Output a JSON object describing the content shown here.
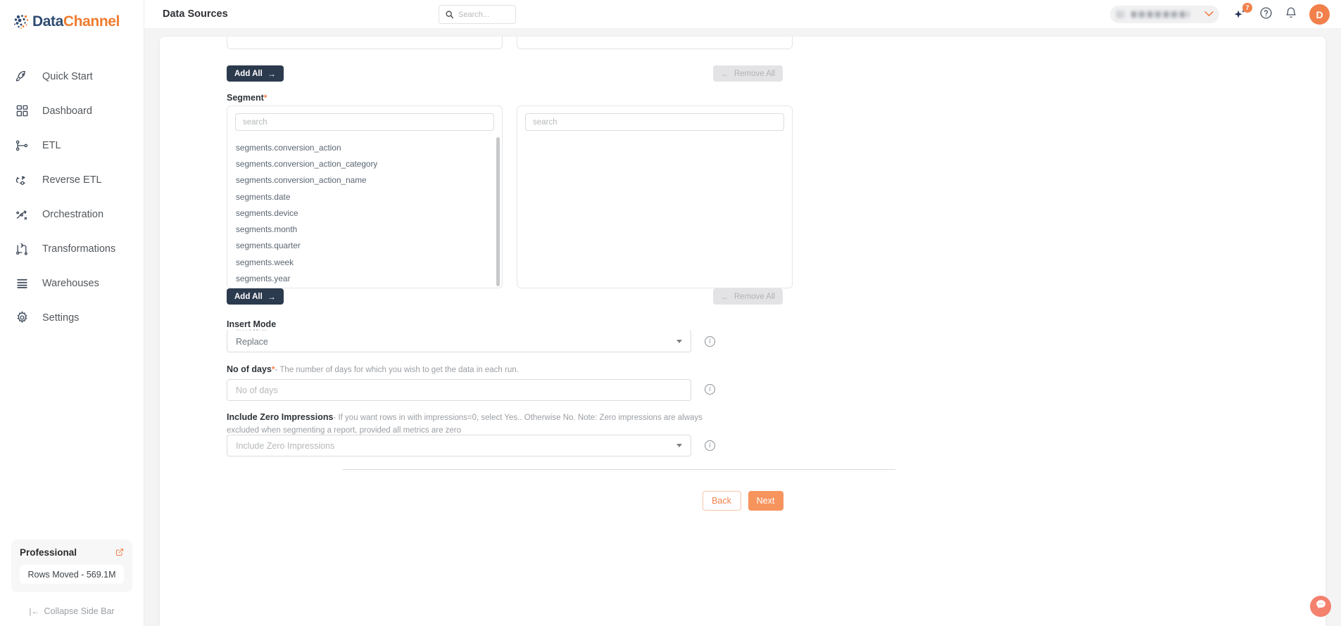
{
  "brand": {
    "name_part1": "Data",
    "name_part2": "Channel",
    "color_primary": "#2f4b72",
    "color_accent": "#f07c2e"
  },
  "sidebar": {
    "items": [
      {
        "label": "Quick Start",
        "icon": "rocket-icon"
      },
      {
        "label": "Dashboard",
        "icon": "grid-icon"
      },
      {
        "label": "ETL",
        "icon": "etl-icon"
      },
      {
        "label": "Reverse ETL",
        "icon": "reverse-etl-icon"
      },
      {
        "label": "Orchestration",
        "icon": "orchestration-icon"
      },
      {
        "label": "Transformations",
        "icon": "transformations-icon"
      },
      {
        "label": "Warehouses",
        "icon": "warehouse-icon"
      },
      {
        "label": "Settings",
        "icon": "gear-icon"
      }
    ],
    "plan": {
      "name": "Professional",
      "external_icon": "external-link-icon",
      "rows_moved": "Rows Moved - 569.1M"
    },
    "collapse": {
      "label": "Collapse Side Bar",
      "icon": "collapse-left-icon"
    }
  },
  "topbar": {
    "title": "Data Sources",
    "search": {
      "placeholder": "Search...",
      "value": "",
      "icon": "search-icon"
    },
    "workspace_selector": {
      "value": "",
      "chevron": "chevron-down-icon"
    },
    "ai_assistant": {
      "icon": "sparkle-icon",
      "badge": "7"
    },
    "help": {
      "icon": "help-circle-icon"
    },
    "notifications": {
      "icon": "bell-icon"
    },
    "avatar": {
      "initial": "D"
    }
  },
  "form": {
    "top_transfer": {
      "add_all_label": "Add All",
      "add_all_arrow": "→",
      "remove_all_label": "Remove All",
      "remove_all_arrow": "←"
    },
    "segment": {
      "label": "Segment",
      "required_mark": "*",
      "left_search_placeholder": "search",
      "right_search_placeholder": "search",
      "available_items": [
        "segments.conversion_action",
        "segments.conversion_action_category",
        "segments.conversion_action_name",
        "segments.date",
        "segments.device",
        "segments.month",
        "segments.quarter",
        "segments.week",
        "segments.year"
      ],
      "selected_items": [],
      "add_all_label": "Add All",
      "add_all_arrow": "→",
      "remove_all_label": "Remove All",
      "remove_all_arrow": "←"
    },
    "insert_mode": {
      "label": "Insert Mode",
      "notch_label": "Insert Mode",
      "value": "Replace",
      "caret": "caret-down-icon",
      "info": "info-icon"
    },
    "no_of_days": {
      "label": "No of days",
      "required_mark": "*",
      "description": "- The number of days for which you wish to get the data in each run.",
      "placeholder": "No of days",
      "value": "",
      "info": "info-icon"
    },
    "include_zero_impressions": {
      "label": "Include Zero Impressions",
      "description": "- If you want rows in with impressions=0, select Yes.. Otherwise No. Note: Zero impressions are always excluded when segmenting a report, provided all metrics are zero",
      "placeholder": "Include Zero Impressions",
      "value": "",
      "caret": "caret-down-icon",
      "info": "info-icon"
    },
    "footer": {
      "back_label": "Back",
      "next_label": "Next"
    }
  },
  "chat_widget": {
    "icon": "chat-bubble-icon",
    "color": "#f4806e"
  }
}
